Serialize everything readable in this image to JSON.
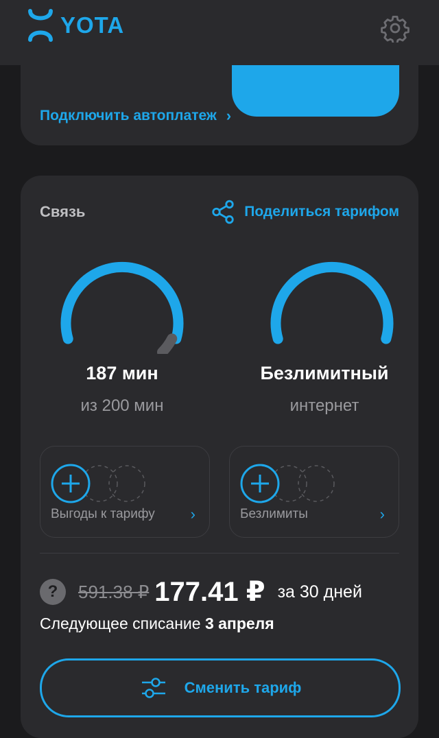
{
  "header": {
    "logo_text": "YOTA"
  },
  "balance_card": {
    "partial_value": "",
    "autopay_label": "Подключить автоплатеж",
    "autopay_chevron": "›"
  },
  "connection": {
    "title": "Связь",
    "share_label": "Поделиться тарифом",
    "minutes": {
      "value": "187 мин",
      "sub": "из 200 мин",
      "used_fraction": 0.935
    },
    "internet": {
      "value": "Безлимитный",
      "sub": "интернет"
    },
    "addons": [
      {
        "label": "Выгоды к тарифу",
        "chevron": "›"
      },
      {
        "label": "Безлимиты",
        "chevron": "›"
      }
    ],
    "price": {
      "help": "?",
      "old": "591.38 ₽",
      "new": "177.41 ₽",
      "period": "за 30 дней"
    },
    "next_charge": {
      "prefix": "Следующее списание ",
      "date": "3 апреля"
    },
    "change_button": "Сменить тариф"
  },
  "colors": {
    "accent": "#1ea7ea",
    "card": "#2a2a2d",
    "background": "#1b1b1d"
  }
}
